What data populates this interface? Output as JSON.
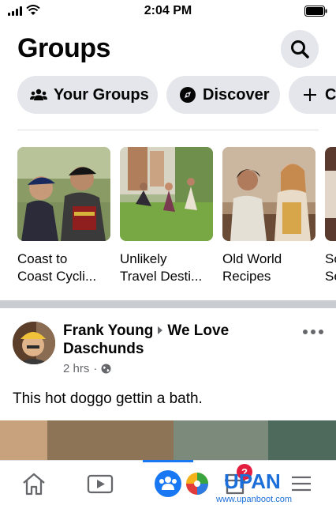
{
  "status_bar": {
    "time": "2:04 PM"
  },
  "header": {
    "title": "Groups"
  },
  "pills": [
    {
      "label": "Your Groups",
      "icon": "people-icon"
    },
    {
      "label": "Discover",
      "icon": "compass-icon"
    },
    {
      "label": "C",
      "icon": "plus-icon"
    }
  ],
  "cards": [
    {
      "title_line1": "Coast to",
      "title_line2": "Coast Cycli..."
    },
    {
      "title_line1": "Unlikely",
      "title_line2": "Travel Desti..."
    },
    {
      "title_line1": "Old World",
      "title_line2": "Recipes"
    },
    {
      "title_line1": "So",
      "title_line2": "Se"
    }
  ],
  "post": {
    "author": "Frank Young",
    "group": "We Love Daschunds",
    "time": "2 hrs",
    "text": "This hot doggo gettin a bath."
  },
  "tab_bar": {
    "tabs": [
      "home-icon",
      "video-icon",
      "groups-icon",
      "marketplace-icon",
      "menu-icon"
    ],
    "badge": "?"
  },
  "watermark": {
    "text": "UPAN",
    "url": "www.upanboot.com"
  },
  "colors": {
    "accent": "#1877f2",
    "pill_bg": "#e4e6eb",
    "badge": "#e41e3f"
  }
}
